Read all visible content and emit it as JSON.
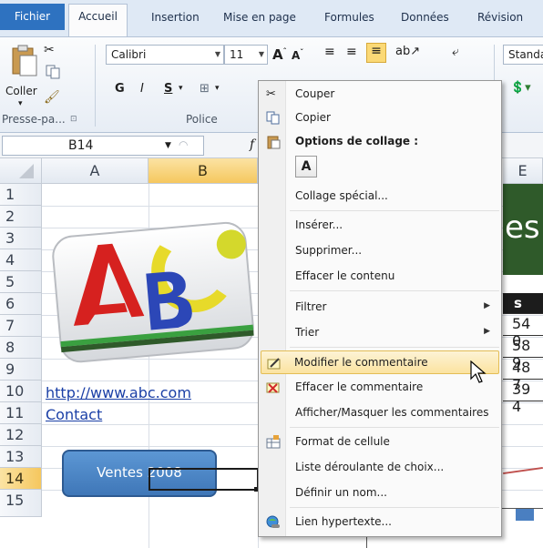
{
  "ribbon": {
    "tabs": [
      "Fichier",
      "Accueil",
      "Insertion",
      "Mise en page",
      "Formules",
      "Données",
      "Révision"
    ],
    "active_tab": "Accueil",
    "font_name": "Calibri",
    "font_size": "11",
    "number_format": "Standa",
    "paste_label": "Coller",
    "groups": [
      "Presse-pa...",
      "Police"
    ],
    "bold": "G",
    "italic": "I",
    "underline": "S"
  },
  "formula_bar": {
    "name_box": "B14",
    "fx": "f"
  },
  "grid": {
    "columns": [
      "A",
      "B",
      "E"
    ],
    "selected_column": "B",
    "rows": [
      "1",
      "2",
      "3",
      "4",
      "5",
      "6",
      "7",
      "8",
      "9",
      "10",
      "11",
      "12",
      "13",
      "14",
      "15"
    ],
    "selected_row": "14",
    "link_1": "http://www.abc.com",
    "link_2": "Contact",
    "button_label": "Ventes 2008",
    "col_e_header": "s",
    "col_e_text": "es",
    "col_e_values": [
      "54 0",
      "58 9",
      "48 7",
      "39 4"
    ]
  },
  "context_menu": {
    "items": [
      {
        "label": "Couper",
        "icon": "scissors-icon"
      },
      {
        "label": "Copier",
        "icon": "copy-icon"
      },
      {
        "label": "Options de collage :",
        "icon": "clipboard-icon",
        "bold": true
      },
      {
        "label": "A",
        "icon": "paste-option-icon"
      },
      {
        "label": "Collage spécial...",
        "icon": ""
      },
      {
        "label": "Insérer...",
        "icon": ""
      },
      {
        "label": "Supprimer...",
        "icon": ""
      },
      {
        "label": "Effacer le contenu",
        "icon": ""
      },
      {
        "label": "Filtrer",
        "icon": "",
        "submenu": true
      },
      {
        "label": "Trier",
        "icon": "",
        "submenu": true
      },
      {
        "label": "Modifier le commentaire",
        "icon": "edit-comment-icon",
        "highlighted": true
      },
      {
        "label": "Effacer le commentaire",
        "icon": "delete-comment-icon"
      },
      {
        "label": "Afficher/Masquer les commentaires",
        "icon": ""
      },
      {
        "label": "Format de cellule",
        "icon": "format-cells-icon"
      },
      {
        "label": "Liste déroulante de choix...",
        "icon": ""
      },
      {
        "label": "Définir un nom...",
        "icon": ""
      },
      {
        "label": "Lien hypertexte...",
        "icon": "hyperlink-icon"
      }
    ]
  },
  "colors": {
    "file_tab": "#2e72c0",
    "selection": "#f5c75e",
    "menu_highlight": "#fbe3a0",
    "link": "#1a3fa6",
    "button_fill": "#4b86c6",
    "dark_green_band": "#2f5a2a"
  }
}
